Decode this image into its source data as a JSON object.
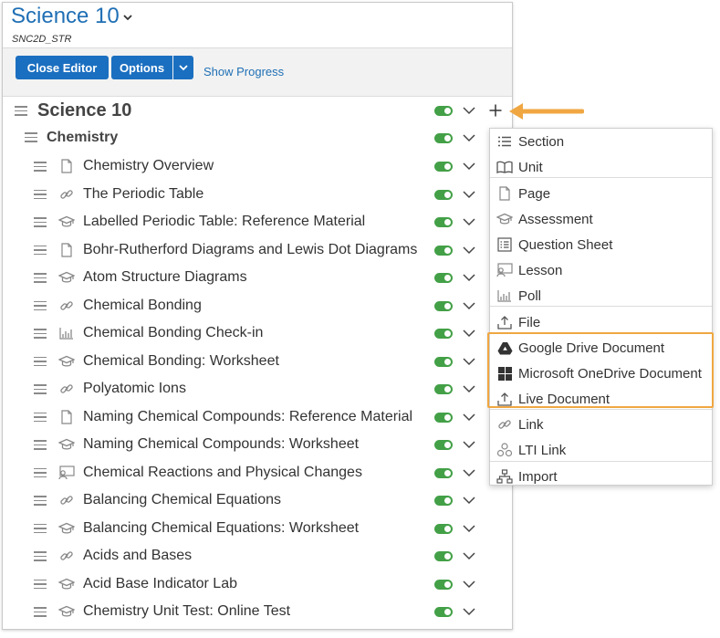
{
  "header": {
    "course_title": "Science 10",
    "course_code": "SNC2D_STR"
  },
  "toolbar": {
    "close_editor": "Close Editor",
    "options": "Options",
    "show_progress": "Show Progress"
  },
  "tree": {
    "root": "Science 10",
    "unit": "Chemistry",
    "items": [
      {
        "label": "Chemistry Overview",
        "icon": "page-icon"
      },
      {
        "label": "The Periodic Table",
        "icon": "link-icon"
      },
      {
        "label": "Labelled Periodic Table: Reference Material",
        "icon": "assessment-icon"
      },
      {
        "label": "Bohr-Rutherford Diagrams and Lewis Dot Diagrams",
        "icon": "page-icon"
      },
      {
        "label": "Atom Structure Diagrams",
        "icon": "assessment-icon"
      },
      {
        "label": "Chemical Bonding",
        "icon": "link-icon"
      },
      {
        "label": "Chemical Bonding Check-in",
        "icon": "poll-icon"
      },
      {
        "label": "Chemical Bonding: Worksheet",
        "icon": "assessment-icon"
      },
      {
        "label": "Polyatomic Ions",
        "icon": "link-icon"
      },
      {
        "label": "Naming Chemical Compounds: Reference Material",
        "icon": "page-icon"
      },
      {
        "label": "Naming Chemical Compounds: Worksheet",
        "icon": "assessment-icon"
      },
      {
        "label": "Chemical Reactions and Physical Changes",
        "icon": "lesson-icon"
      },
      {
        "label": "Balancing Chemical Equations",
        "icon": "link-icon"
      },
      {
        "label": "Balancing Chemical Equations: Worksheet",
        "icon": "assessment-icon"
      },
      {
        "label": "Acids and Bases",
        "icon": "link-icon"
      },
      {
        "label": "Acid Base Indicator Lab",
        "icon": "assessment-icon"
      },
      {
        "label": "Chemistry Unit Test: Online Test",
        "icon": "assessment-icon"
      }
    ]
  },
  "add_menu": {
    "items": [
      {
        "label": "Section",
        "icon": "section-icon"
      },
      {
        "label": "Unit",
        "icon": "unit-icon"
      },
      {
        "label": "Page",
        "icon": "page-icon"
      },
      {
        "label": "Assessment",
        "icon": "assessment-icon"
      },
      {
        "label": "Question Sheet",
        "icon": "question-sheet-icon"
      },
      {
        "label": "Lesson",
        "icon": "lesson-icon"
      },
      {
        "label": "Poll",
        "icon": "poll-icon"
      },
      {
        "label": "File",
        "icon": "upload-icon"
      },
      {
        "label": "Google Drive Document",
        "icon": "google-drive-icon"
      },
      {
        "label": "Microsoft OneDrive Document",
        "icon": "microsoft-icon"
      },
      {
        "label": "Live Document",
        "icon": "upload-icon"
      },
      {
        "label": "Link",
        "icon": "link-icon"
      },
      {
        "label": "LTI Link",
        "icon": "lti-icon"
      },
      {
        "label": "Import",
        "icon": "import-icon"
      }
    ]
  },
  "colors": {
    "accent_blue": "#1b6fc0",
    "toggle_green": "#43a047",
    "highlight_orange": "#f0a742"
  }
}
